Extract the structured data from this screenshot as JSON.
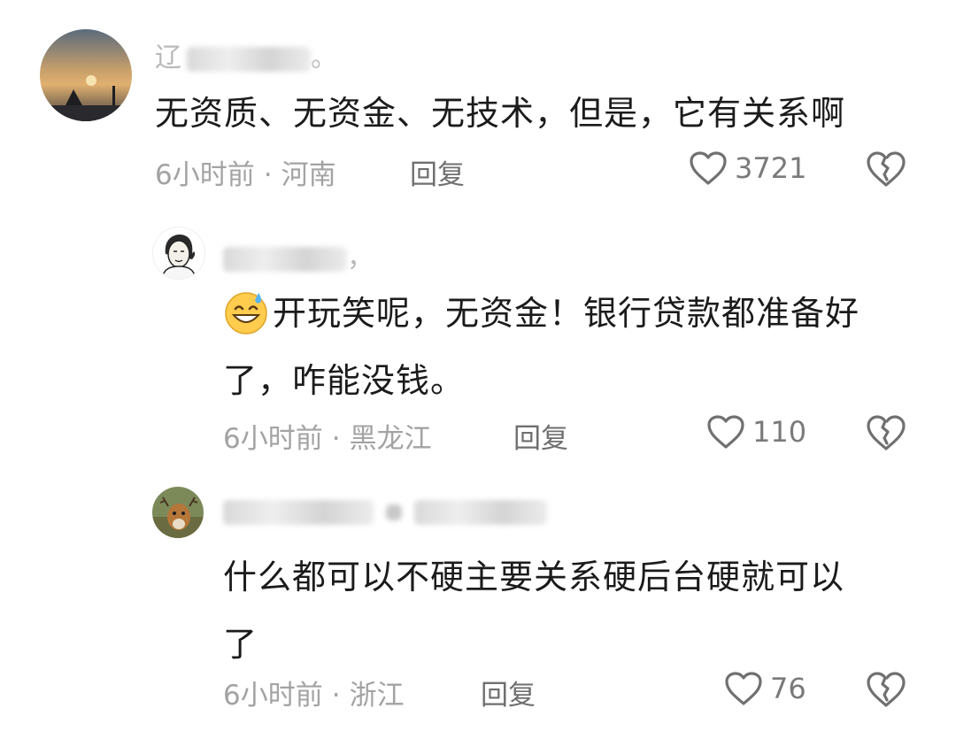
{
  "comments": [
    {
      "username_visible": "辽",
      "username_suffix": "。",
      "text": "无资质、无资金、无技术，但是，它有关系啊",
      "time": "6小时前",
      "separator": "·",
      "location": "河南",
      "reply_label": "回复",
      "likes": "3721"
    },
    {
      "username_visible": "",
      "username_suffix": "，",
      "emoji": "grinning-sweat-emoji",
      "text_line1": "开玩笑呢，无资金！银行贷款都准备好",
      "text_line2": "了，咋能没钱。",
      "time": "6小时前",
      "separator": "·",
      "location": "黑龙江",
      "reply_label": "回复",
      "likes": "110"
    },
    {
      "username_visible": "",
      "username_suffix": "",
      "text_line1": "什么都可以不硬主要关系硬后台硬就可以",
      "text_line2": "了",
      "time": "6小时前",
      "separator": "·",
      "location": "浙江",
      "reply_label": "回复",
      "likes": "76"
    }
  ],
  "icons": {
    "like": "heart-outline-icon",
    "dislike": "broken-heart-icon"
  },
  "colors": {
    "text": "#1b1b1b",
    "meta": "#a3a3a3",
    "reply": "#6f6f6f"
  }
}
